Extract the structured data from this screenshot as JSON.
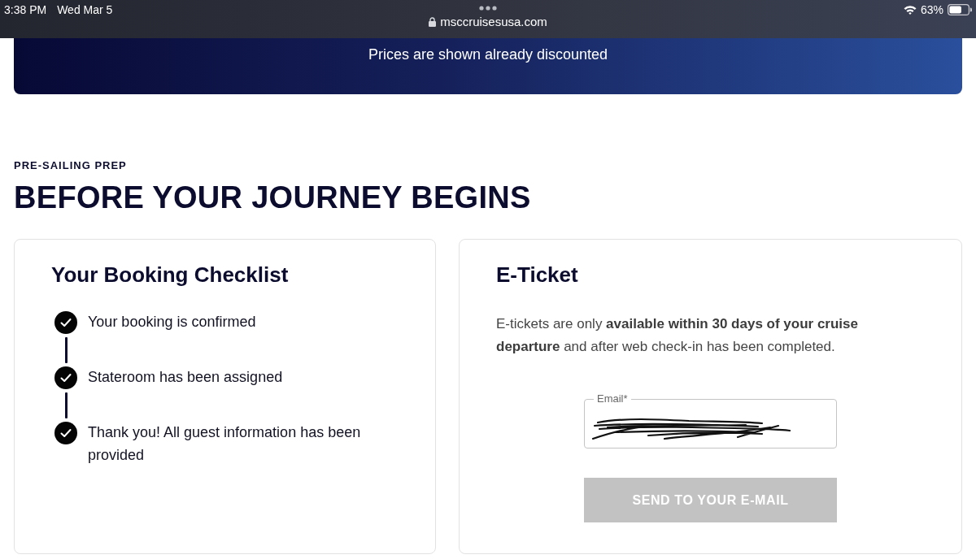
{
  "status_bar": {
    "time": "3:38 PM",
    "date": "Wed Mar 5",
    "url": "msccruisesusa.com",
    "battery": "63%"
  },
  "banner": {
    "text": "Prices are shown already discounted"
  },
  "section": {
    "eyebrow": "PRE-SAILING PREP",
    "title": "BEFORE YOUR JOURNEY BEGINS"
  },
  "checklist": {
    "title": "Your Booking Checklist",
    "items": [
      {
        "label": "Your booking is confirmed",
        "checked": true
      },
      {
        "label": "Stateroom has been assigned",
        "checked": true
      },
      {
        "label": "Thank you! All guest information has been provided",
        "checked": true
      }
    ]
  },
  "eticket": {
    "title": "E-Ticket",
    "description": "E-tickets are only **available within 30 days of your cruise departure** and after web check-in has been completed.",
    "email_field": {
      "label": "Email*",
      "redacted": true
    },
    "button": {
      "label": "SEND TO YOUR E-MAIL",
      "disabled": true
    }
  }
}
